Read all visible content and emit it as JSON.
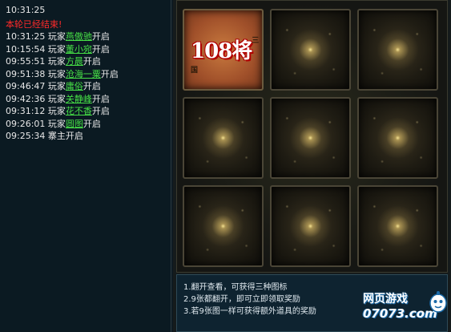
{
  "log": {
    "current_time": "10:31:25",
    "round_status": "本轮已经结束!",
    "entries": [
      {
        "time": "10:31:25",
        "prefix": "玩家",
        "name": "燕傲驰",
        "action": "开启"
      },
      {
        "time": "10:15:54",
        "prefix": "玩家",
        "name": "董小宛",
        "action": "开启"
      },
      {
        "time": "09:55:51",
        "prefix": "玩家",
        "name": "方晨",
        "action": "开启"
      },
      {
        "time": "09:51:38",
        "prefix": "玩家",
        "name": "沧海一粟",
        "action": "开启"
      },
      {
        "time": "09:46:47",
        "prefix": "玩家",
        "name": "庸俗",
        "action": "开启"
      },
      {
        "time": "09:42:36",
        "prefix": "玩家",
        "name": "关静峰",
        "action": "开启"
      },
      {
        "time": "09:31:12",
        "prefix": "玩家",
        "name": "花不香",
        "action": "开启"
      },
      {
        "time": "09:26:01",
        "prefix": "玩家",
        "name": "圆图",
        "action": "开启"
      },
      {
        "time": "09:25:34",
        "prefix": "",
        "name": "",
        "action": "寨主开启"
      }
    ]
  },
  "board": {
    "cards": [
      {
        "state": "revealed",
        "logo": "108将",
        "logo_sub": "三国"
      },
      {
        "state": "hidden"
      },
      {
        "state": "hidden"
      },
      {
        "state": "hidden"
      },
      {
        "state": "hidden"
      },
      {
        "state": "hidden"
      },
      {
        "state": "hidden"
      },
      {
        "state": "hidden"
      },
      {
        "state": "hidden"
      }
    ]
  },
  "instructions": [
    "1.翻开查看，可获得三种图标",
    "2.9张都翻开，即可立即领取奖励",
    "3.若9张图一样可获得额外道具的奖励"
  ],
  "watermark": {
    "line1": "网页游戏",
    "line2": "07073.com"
  },
  "colors": {
    "player_name": "#46e046",
    "status_red": "#ff2a2a",
    "text": "#e8e8e8"
  }
}
